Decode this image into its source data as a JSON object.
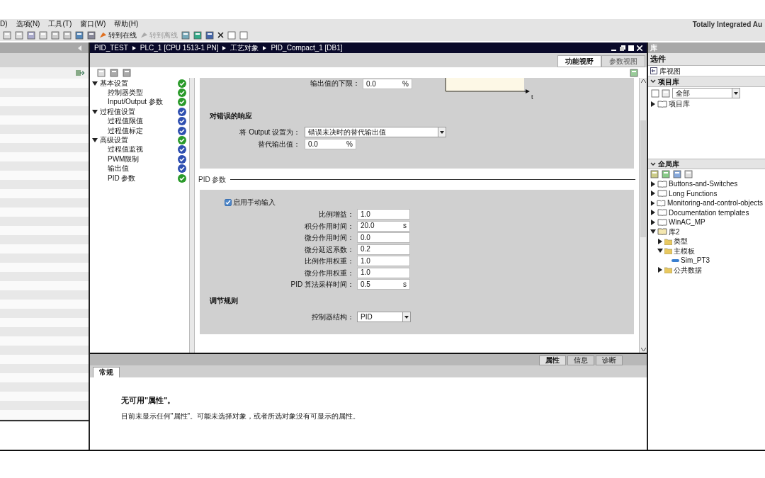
{
  "menu": [
    {
      "label": "D)"
    },
    {
      "label": "选项(N)"
    },
    {
      "label": "工具(T)"
    },
    {
      "label": "窗口(W)"
    },
    {
      "label": "帮助(H)"
    }
  ],
  "toolbar": {
    "go_online": "转到在线",
    "go_offline": "转到离线",
    "go_offline_disabled": true
  },
  "brand": "Totally Integrated Au",
  "editor": {
    "breadcrumb": [
      "PID_TEST",
      "PLC_1 [CPU 1513-1 PN]",
      "工艺对象",
      "PID_Compact_1 [DB1]"
    ],
    "view_tabs": [
      {
        "label": "功能视野",
        "selected": true
      },
      {
        "label": "参数视图",
        "selected": false
      }
    ],
    "nav": [
      {
        "label": "基本设置",
        "color": "#2a9a2a",
        "expanded": true,
        "children": [
          {
            "label": "控制器类型",
            "color": "#2a9a2a"
          },
          {
            "label": "Input/Output 参数",
            "color": "#2a9a2a"
          }
        ]
      },
      {
        "label": "过程值设置",
        "color": "#2f4fb0",
        "expanded": true,
        "children": [
          {
            "label": "过程值限值",
            "color": "#2f4fb0"
          },
          {
            "label": "过程值标定",
            "color": "#2f4fb0"
          }
        ]
      },
      {
        "label": "高级设置",
        "color": "#2a9a2a",
        "expanded": true,
        "children": [
          {
            "label": "过程值监视",
            "color": "#2f4fb0"
          },
          {
            "label": "PWM限制",
            "color": "#2f4fb0"
          },
          {
            "label": "输出值",
            "color": "#2f4fb0"
          },
          {
            "label": "PID 参数",
            "color": "#2a9a2a"
          }
        ]
      }
    ],
    "cut_row": {
      "label": "输出值的下限：",
      "value": "0.0",
      "unit": "%"
    },
    "axis_label": "t",
    "error_section": {
      "title": "对错误的响应",
      "output_label": "将 Output 设置为：",
      "output_value": "错误未决时的替代输出值",
      "subst_label": "替代输出值：",
      "subst_value": "0.0",
      "subst_unit": "%"
    },
    "pid_section": {
      "title": "PID 参数",
      "manual": {
        "label": "启用手动输入",
        "checked": true
      },
      "params": [
        {
          "label": "比例增益：",
          "value": "1.0"
        },
        {
          "label": "积分作用时间：",
          "value": "20.0",
          "unit": "s"
        },
        {
          "label": "微分作用时间：",
          "value": "0.0"
        },
        {
          "label": "微分延迟系数：",
          "value": "0.2"
        },
        {
          "label": "比例作用权重：",
          "value": "1.0"
        },
        {
          "label": "微分作用权重：",
          "value": "1.0"
        },
        {
          "label": "PID 算法采样时间：",
          "value": "0.5",
          "unit": "s"
        }
      ],
      "rule_title": "调节规则",
      "structure_label": "控制器结构：",
      "structure_value": "PID"
    }
  },
  "inspector": {
    "tabs": [
      {
        "label": "属性",
        "selected": true
      },
      {
        "label": "信息",
        "selected": false
      },
      {
        "label": "诊断",
        "selected": false
      }
    ],
    "subtab": "常规",
    "message_title": "无可用\"属性\"。",
    "message": "目前未显示任何\"属性\"。可能未选择对象，或者所选对象没有可显示的属性。"
  },
  "library": {
    "header": "库",
    "options": "选件",
    "library_view": "库视图",
    "project_lib": {
      "title": "项目库",
      "filter": "全部",
      "items": [
        {
          "label": "项目库",
          "expanded": false
        }
      ]
    },
    "global_lib": {
      "title": "全局库",
      "items": [
        {
          "label": "Buttons-and-Switches",
          "expanded": false
        },
        {
          "label": "Long Functions",
          "expanded": false
        },
        {
          "label": "Monitoring-and-control-objects",
          "expanded": false
        },
        {
          "label": "Documentation templates",
          "expanded": false
        },
        {
          "label": "WinAC_MP",
          "expanded": false
        },
        {
          "label": "库2",
          "expanded": true,
          "children": [
            {
              "label": "类型",
              "expanded": false
            },
            {
              "label": "主模板",
              "expanded": true,
              "children": [
                {
                  "label": "Sim_PT3"
                }
              ]
            },
            {
              "label": "公共数据",
              "expanded": false
            }
          ]
        }
      ]
    }
  }
}
